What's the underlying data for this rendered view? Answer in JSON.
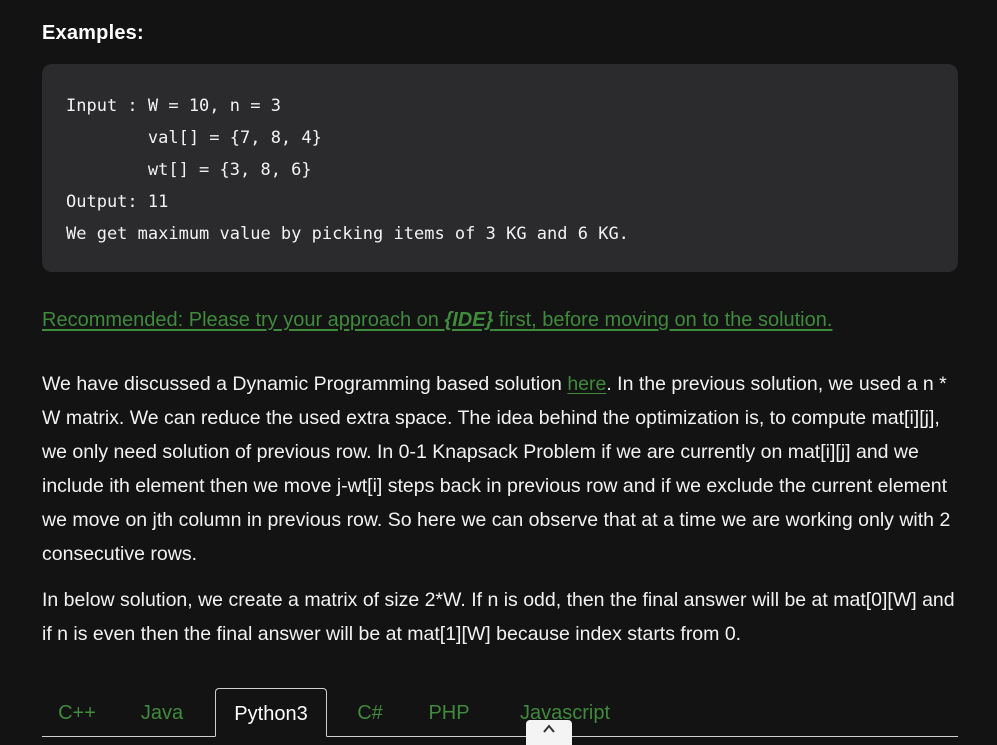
{
  "examples": {
    "heading": "Examples:",
    "code_lines": [
      "Input : W = 10, n = 3",
      "        val[] = {7, 8, 4}",
      "        wt[] = {3, 8, 6}",
      "Output: 11",
      "We get maximum value by picking items of 3 KG and 6 KG."
    ]
  },
  "recommended": {
    "prefix": "Recommended: Please try your approach on ",
    "ide": "{IDE}",
    "suffix": " first, before moving on to the solution."
  },
  "paragraph1": {
    "before_link": "We have discussed a Dynamic Programming based solution ",
    "link": "here",
    "after_link": ". In the previous solution, we used a n * W matrix. We can reduce the used extra space. The idea behind the optimization is, to compute mat[i][j], we only need solution of previous row. In 0-1 Knapsack Problem if we are currently on mat[i][j] and we include ith element then we move j-wt[i] steps back in previous row and if we exclude the current element we move on jth column in previous row. So here we can observe that at a time we are working only with 2 consecutive rows."
  },
  "paragraph2": {
    "text": "In below solution, we create a matrix of size 2*W. If n is odd, then the final answer will be at mat[0][W] and if n is even then the final answer will be at mat[1][W] because index starts from 0."
  },
  "tabs": {
    "items": [
      "C++",
      "Java",
      "Python3",
      "C#",
      "PHP",
      "Javascript"
    ],
    "active": "Python3"
  },
  "colors": {
    "background": "#131313",
    "code_background": "#2b2b2d",
    "link_green": "#3f8a3b",
    "text": "#f2f2f2"
  },
  "icons": {
    "scroll_up": "chevron-up-icon"
  }
}
